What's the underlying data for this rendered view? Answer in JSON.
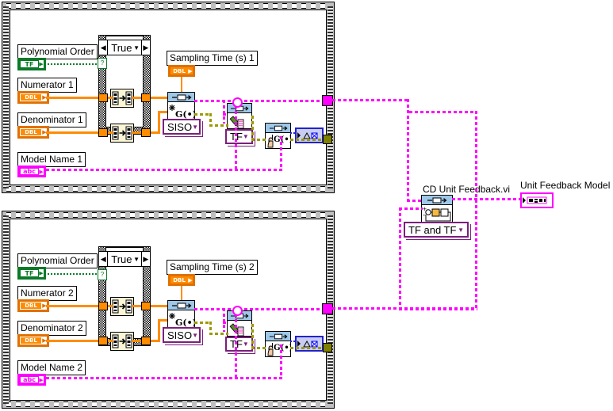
{
  "app": {
    "kind": "LabVIEW block diagram",
    "title": "Block Diagram"
  },
  "frames": [
    {
      "name": "top-loop",
      "case_selector": {
        "value": "True",
        "left_arrow": "◀",
        "right_arrow": "▶",
        "chevron": "▼"
      },
      "controls": [
        {
          "label": "Polynomial Order",
          "terminal": "TF",
          "type": "boolean"
        },
        {
          "label": "Numerator 1",
          "terminal": "DBL",
          "type": "dbl-array"
        },
        {
          "label": "Denominator 1",
          "terminal": "DBL",
          "type": "dbl-array"
        },
        {
          "label": "Model Name 1",
          "terminal": "abc",
          "type": "string"
        },
        {
          "label": "Sampling Time (s) 1",
          "terminal": "DBL",
          "type": "dbl"
        }
      ],
      "constants": [
        {
          "label": "SISO",
          "chevron": "▼"
        },
        {
          "label": "TF",
          "chevron": "▼"
        }
      ],
      "nodes": [
        {
          "name": "array-reverse-1",
          "icon": "array-transform-icon"
        },
        {
          "name": "array-reverse-2",
          "icon": "array-transform-icon"
        },
        {
          "name": "cd-construct-transfer-function-model",
          "icon": "g-of-s-icon",
          "glyph": "G(•)"
        },
        {
          "name": "cd-draw-transfer-function-equation",
          "icon": "pencil-write-icon"
        },
        {
          "name": "cd-model-display",
          "icon": "hand-g-icon",
          "glyph": "G(•)"
        }
      ],
      "indicators": [
        {
          "name": "error-out",
          "type": "error-cluster"
        }
      ]
    },
    {
      "name": "bottom-loop",
      "case_selector": {
        "value": "True",
        "left_arrow": "◀",
        "right_arrow": "▶",
        "chevron": "▼"
      },
      "controls": [
        {
          "label": "Polynomial Order",
          "terminal": "TF",
          "type": "boolean"
        },
        {
          "label": "Numerator 2",
          "terminal": "DBL",
          "type": "dbl-array"
        },
        {
          "label": "Denominator 2",
          "terminal": "DBL",
          "type": "dbl-array"
        },
        {
          "label": "Model Name 2",
          "terminal": "abc",
          "type": "string"
        },
        {
          "label": "Sampling Time (s) 2",
          "terminal": "DBL",
          "type": "dbl"
        }
      ],
      "constants": [
        {
          "label": "SISO",
          "chevron": "▼"
        },
        {
          "label": "TF",
          "chevron": "▼"
        }
      ],
      "nodes": [
        {
          "name": "array-reverse-1",
          "icon": "array-transform-icon"
        },
        {
          "name": "array-reverse-2",
          "icon": "array-transform-icon"
        },
        {
          "name": "cd-construct-transfer-function-model",
          "icon": "g-of-s-icon",
          "glyph": "G(•)"
        },
        {
          "name": "cd-draw-transfer-function-equation",
          "icon": "pencil-write-icon"
        },
        {
          "name": "cd-model-display",
          "icon": "hand-g-icon",
          "glyph": "G(•)"
        }
      ],
      "indicators": [
        {
          "name": "error-out",
          "type": "error-cluster"
        }
      ]
    }
  ],
  "right_section": {
    "subvi": {
      "title": "CD Unit Feedback.vi",
      "icon": "unit-feedback-icon"
    },
    "enum": {
      "label": "TF and TF",
      "chevron": "▼"
    },
    "indicator": {
      "label": "Unit Feedback Model",
      "type": "cluster"
    }
  },
  "labels": {
    "polynomial_order_top": "Polynomial Order",
    "numerator_top": "Numerator 1",
    "denominator_top": "Denominator 1",
    "model_name_top": "Model Name 1",
    "sampling_time_top": "Sampling Time (s) 1",
    "polynomial_order_bottom": "Polynomial Order",
    "numerator_bottom": "Numerator 2",
    "denominator_bottom": "Denominator 2",
    "model_name_bottom": "Model Name 2",
    "sampling_time_bottom": "Sampling Time (s) 2",
    "siso_top": "SISO",
    "siso_bottom": "SISO",
    "tf_enum_top": "TF",
    "tf_enum_bottom": "TF",
    "tf_term_top": "TF",
    "tf_term_bottom": "TF",
    "abc_top": "abc",
    "abc_bottom": "abc",
    "dbl": "DBL",
    "case_true_top": "True",
    "case_true_bottom": "True",
    "subvi_title": "CD Unit Feedback.vi",
    "tf_and_tf": "TF and TF",
    "unit_feedback_model": "Unit Feedback Model",
    "g_glyph": "G(•)"
  },
  "colors": {
    "orange_wire": "#ff8c00",
    "magenta_wire": "#ff00ff",
    "green_boolean": "#0a7a28",
    "blue_error": "#2222cc",
    "olive_wire": "#9a9a00",
    "purple_enum": "#7b1f7b",
    "node_header": "#9fc8e8",
    "structure_gray": "#bfbfbf"
  }
}
